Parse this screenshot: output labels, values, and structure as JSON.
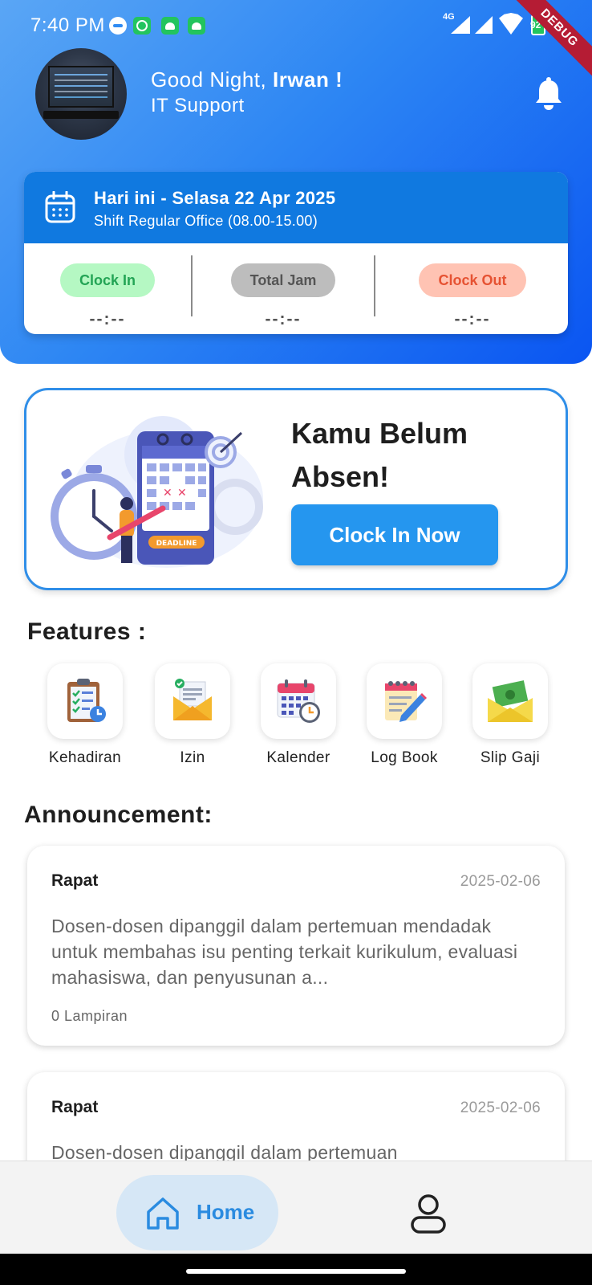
{
  "status_bar": {
    "time": "7:40 PM",
    "network": "4G",
    "battery": "92",
    "debug_label": "DEBUG"
  },
  "header": {
    "greeting_prefix": "Good Night, ",
    "user_name": "Irwan !",
    "role": "IT Support"
  },
  "today": {
    "title": "Hari ini - Selasa 22 Apr 2025",
    "shift": "Shift Regular Office (08.00-15.00)",
    "clock_in_label": "Clock In",
    "clock_in_value": "--:--",
    "total_label": "Total Jam",
    "total_value": "--:--",
    "clock_out_label": "Clock Out",
    "clock_out_value": "--:--"
  },
  "absen": {
    "title": "Kamu Belum Absen!",
    "button": "Clock In Now",
    "deadline_tag": "DEADLINE"
  },
  "features": {
    "title": "Features :",
    "items": [
      {
        "label": "Kehadiran",
        "icon": "clipboard-checklist-icon"
      },
      {
        "label": "Izin",
        "icon": "envelope-letter-icon"
      },
      {
        "label": "Kalender",
        "icon": "calendar-clock-icon"
      },
      {
        "label": "Log Book",
        "icon": "notepad-pencil-icon"
      },
      {
        "label": "Slip Gaji",
        "icon": "money-envelope-icon"
      }
    ]
  },
  "announcement": {
    "title": "Announcement:",
    "items": [
      {
        "title": "Rapat",
        "date": "2025-02-06",
        "body": "Dosen-dosen dipanggil dalam pertemuan mendadak untuk membahas isu penting terkait kurikulum, evaluasi mahasiswa, dan penyusunan a...",
        "attachments": "0 Lampiran"
      },
      {
        "title": "Rapat",
        "date": "2025-02-06",
        "body": "Dosen-dosen dipanggil dalam pertemuan",
        "attachments": ""
      }
    ]
  },
  "bottom_nav": {
    "home_label": "Home"
  },
  "colors": {
    "primary": "#2596ef",
    "header_start": "#5aa6f5",
    "header_end": "#0a55f2",
    "clock_in": "#23a455",
    "clock_out": "#e65232"
  }
}
